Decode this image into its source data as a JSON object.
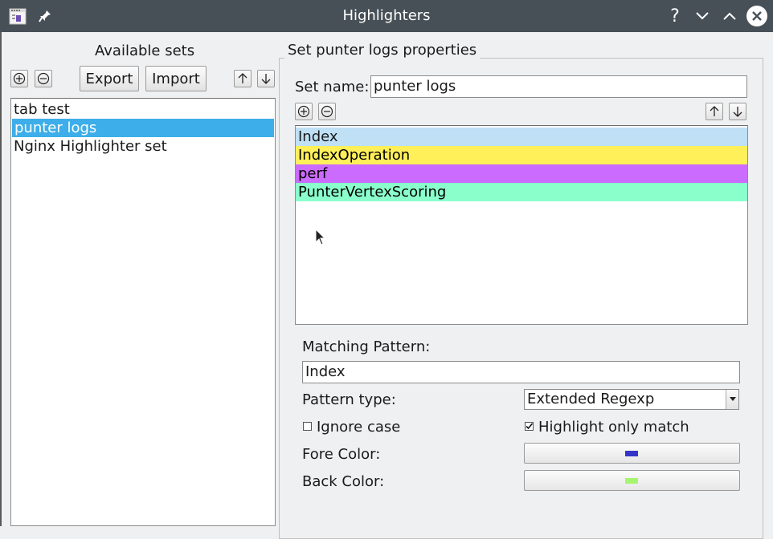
{
  "window": {
    "title": "Highlighters",
    "app_icon": "application-icon",
    "pin_icon": "pin-icon",
    "help_label": "?",
    "colors": {
      "titlebar": "#475057",
      "selection": "#3daee9"
    }
  },
  "left": {
    "header": "Available sets",
    "export_label": "Export",
    "import_label": "Import",
    "sets": [
      {
        "label": "tab test",
        "selected": false
      },
      {
        "label": "punter logs",
        "selected": true
      },
      {
        "label": "Nginx Highlighter set",
        "selected": false
      }
    ]
  },
  "right": {
    "group_title": "Set punter logs properties",
    "set_name_label": "Set name:",
    "set_name_value": "punter logs",
    "highlighters": [
      {
        "label": "Index",
        "bg": "#bfe0f5",
        "fg": "#1a1a1a"
      },
      {
        "label": "IndexOperation",
        "bg": "#fff05a",
        "fg": "#000000"
      },
      {
        "label": "perf",
        "bg": "#cc6bff",
        "fg": "#000000"
      },
      {
        "label": "PunterVertexScoring",
        "bg": "#8affcc",
        "fg": "#000000"
      }
    ],
    "matching_pattern_label": "Matching Pattern:",
    "matching_pattern_value": "Index",
    "pattern_type_label": "Pattern type:",
    "pattern_type_value": "Extended Regexp",
    "ignore_case_label": "Ignore case",
    "ignore_case_checked": false,
    "highlight_only_match_label": "Highlight only match",
    "highlight_only_match_checked": true,
    "fore_color_label": "Fore Color:",
    "fore_color": "#3535c8",
    "back_color_label": "Back Color:",
    "back_color": "#a6f56e"
  }
}
